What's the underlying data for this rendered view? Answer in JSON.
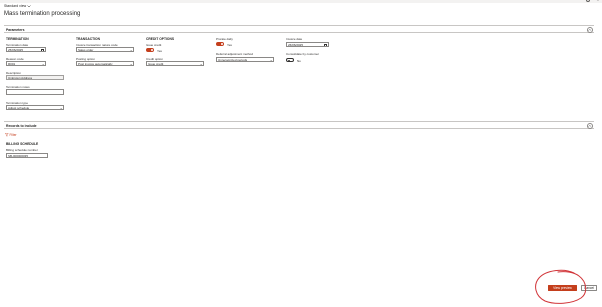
{
  "window": {
    "close_glyph": "×"
  },
  "view": {
    "label": "Standard view"
  },
  "page": {
    "title": "Mass termination processing"
  },
  "parameters": {
    "title": "Parameters",
    "termination": {
      "heading": "TERMINATION",
      "termination_date_label": "Termination date",
      "termination_date_value": "25/06/2025",
      "reason_code_label": "Reason code",
      "reason_code_value": "R001",
      "description_label": "Description",
      "description_value": "Unknown Address",
      "termination_notes_label": "Termination notes",
      "termination_notes_value": "",
      "termination_type_label": "Termination type",
      "termination_type_value": "Adjust schedule"
    },
    "transaction": {
      "heading": "TRANSACTION",
      "invoice_txn_code_label": "Invoice transaction nature code",
      "invoice_txn_code_value": "Sales order",
      "posting_option_label": "Posting option",
      "posting_option_value": "Post invoice automatically"
    },
    "credit_options": {
      "heading": "CREDIT OPTIONS",
      "issue_credit_label": "Issue credit",
      "issue_credit_value": "Yes",
      "credit_option_label": "Credit option",
      "credit_option_value": "Issue credit"
    },
    "prorate": {
      "prorate_daily_label": "Prorate daily",
      "prorate_daily_value": "Yes",
      "deferral_method_label": "Deferral adjustment method",
      "deferral_method_value": "Unrecognized periods"
    },
    "invoice": {
      "invoice_date_label": "Invoice date",
      "invoice_date_value": "26/06/2025",
      "consolidate_label": "Consolidate by customer",
      "consolidate_value": "No"
    }
  },
  "records": {
    "title": "Records to include",
    "filter_label": "Filter",
    "billing_heading": "BILLING SCHEDULE",
    "billing_number_label": "Billing schedule number",
    "billing_number_value": "SB-000000035"
  },
  "actions": {
    "view_preview_label": "View preview",
    "cancel_label": "Cancel"
  },
  "colors": {
    "accent": "#c43e1c",
    "annotation": "#d13438"
  }
}
